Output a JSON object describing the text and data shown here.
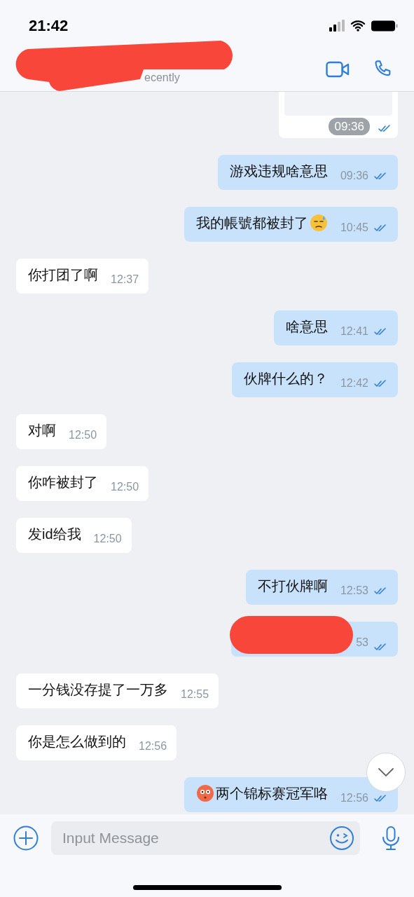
{
  "status_bar": {
    "time": "21:42"
  },
  "header": {
    "subtitle": "ecently",
    "redacted": true
  },
  "messages": [
    {
      "kind": "image",
      "outgoing": true,
      "time": "09:36"
    },
    {
      "kind": "text",
      "outgoing": true,
      "parts": [
        {
          "kind": "text",
          "text": "游戏违规啥意思"
        }
      ],
      "time": "09:36"
    },
    {
      "kind": "text",
      "outgoing": true,
      "parts": [
        {
          "kind": "text",
          "text": "我的帳號都被封了"
        },
        {
          "kind": "sweat"
        }
      ],
      "time": "10:45"
    },
    {
      "kind": "text",
      "outgoing": false,
      "parts": [
        {
          "kind": "text",
          "text": "你打团了啊"
        }
      ],
      "time": "12:37"
    },
    {
      "kind": "text",
      "outgoing": true,
      "parts": [
        {
          "kind": "text",
          "text": "啥意思"
        }
      ],
      "time": "12:41"
    },
    {
      "kind": "text",
      "outgoing": true,
      "parts": [
        {
          "kind": "text",
          "text": "伙牌什么的？"
        }
      ],
      "time": "12:42"
    },
    {
      "kind": "text",
      "outgoing": false,
      "parts": [
        {
          "kind": "text",
          "text": "对啊"
        }
      ],
      "time": "12:50"
    },
    {
      "kind": "text",
      "outgoing": false,
      "parts": [
        {
          "kind": "text",
          "text": "你咋被封了"
        }
      ],
      "time": "12:50"
    },
    {
      "kind": "text",
      "outgoing": false,
      "parts": [
        {
          "kind": "text",
          "text": "发id给我"
        }
      ],
      "time": "12:50"
    },
    {
      "kind": "text",
      "outgoing": true,
      "parts": [
        {
          "kind": "text",
          "text": "不打伙牌啊"
        }
      ],
      "time": "12:53"
    },
    {
      "kind": "redacted",
      "outgoing": true,
      "time": "53"
    },
    {
      "kind": "text",
      "outgoing": false,
      "parts": [
        {
          "kind": "text",
          "text": "一分钱没存提了一万多"
        }
      ],
      "time": "12:55"
    },
    {
      "kind": "text",
      "outgoing": false,
      "parts": [
        {
          "kind": "text",
          "text": "你是怎么做到的"
        }
      ],
      "time": "12:56"
    },
    {
      "kind": "text",
      "outgoing": true,
      "parts": [
        {
          "kind": "flushed"
        },
        {
          "kind": "text",
          "text": "两个锦标赛冠军咯"
        }
      ],
      "time": "12:56"
    }
  ],
  "input": {
    "placeholder": "Input Message"
  }
}
